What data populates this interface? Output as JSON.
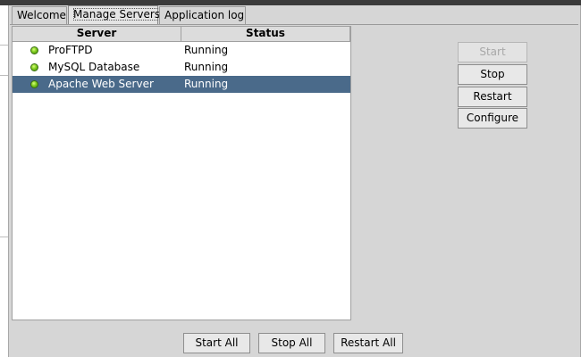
{
  "tabs": [
    {
      "label": "Welcome",
      "active": false
    },
    {
      "label": "Manage Servers",
      "active": true
    },
    {
      "label": "Application log",
      "active": false
    }
  ],
  "table": {
    "columns": [
      "Server",
      "Status"
    ],
    "rows": [
      {
        "name": "ProFTPD",
        "status": "Running",
        "selected": false,
        "indicator": "green"
      },
      {
        "name": "MySQL Database",
        "status": "Running",
        "selected": false,
        "indicator": "green"
      },
      {
        "name": "Apache Web Server",
        "status": "Running",
        "selected": true,
        "indicator": "green"
      }
    ]
  },
  "side_buttons": {
    "start": {
      "label": "Start",
      "enabled": false
    },
    "stop": {
      "label": "Stop",
      "enabled": true
    },
    "restart": {
      "label": "Restart",
      "enabled": true
    },
    "configure": {
      "label": "Configure",
      "enabled": true
    }
  },
  "bottom_buttons": {
    "start_all": "Start All",
    "stop_all": "Stop All",
    "restart_all": "Restart All"
  },
  "colors": {
    "selection": "#4a6a8a",
    "indicator_running": "#7fcc1e",
    "background_text_red": "#c84a2a"
  }
}
